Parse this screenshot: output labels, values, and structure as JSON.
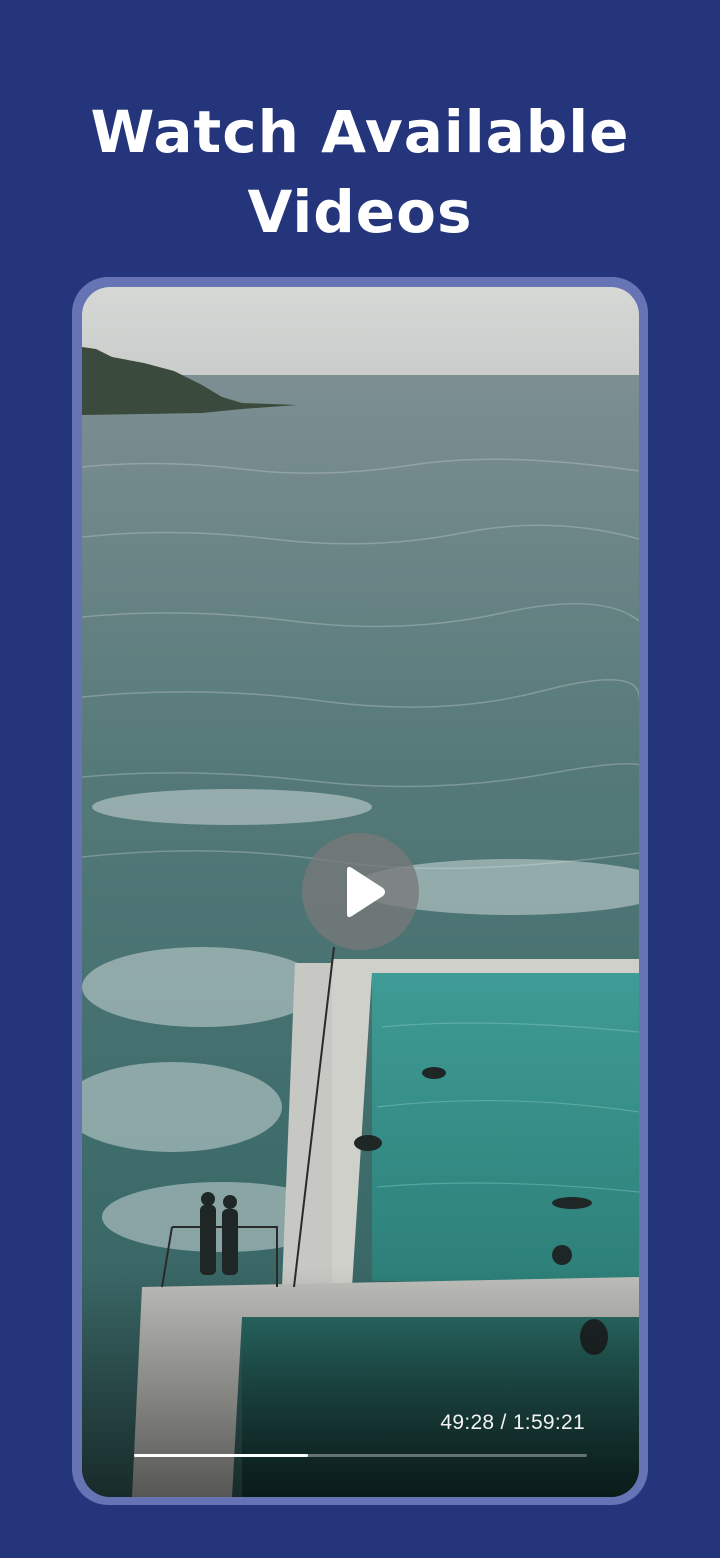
{
  "headline": {
    "line1": "Watch Available",
    "line2": "Videos"
  },
  "player": {
    "current_time": "49:28",
    "separator": " / ",
    "duration": "1:59:21",
    "progress": 0.384,
    "play_icon": "play-icon"
  },
  "colors": {
    "background": "#24357c",
    "frame": "#6673b4",
    "text": "#ffffff"
  }
}
